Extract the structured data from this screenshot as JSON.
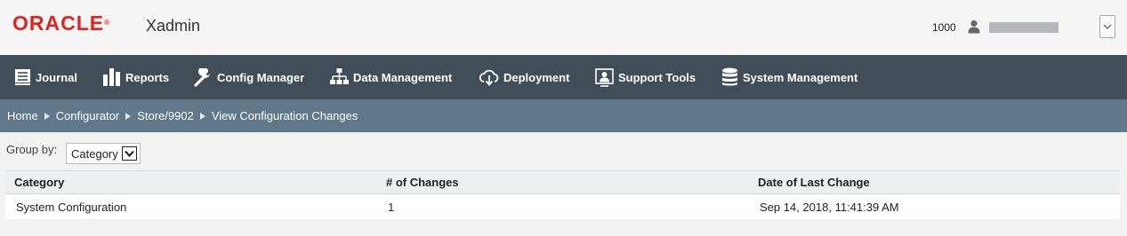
{
  "header": {
    "brand": "ORACLE",
    "brand_mark": "®",
    "app_title": "Xadmin",
    "store_number": "1000",
    "user_icon": "user-icon",
    "dropdown_icon": "chevron-down-icon"
  },
  "nav": {
    "items": [
      {
        "label": "Journal",
        "icon": "journal-icon"
      },
      {
        "label": "Reports",
        "icon": "reports-bar-chart-icon"
      },
      {
        "label": "Config Manager",
        "icon": "wrench-icon"
      },
      {
        "label": "Data Management",
        "icon": "hierarchy-icon"
      },
      {
        "label": "Deployment",
        "icon": "cloud-download-icon"
      },
      {
        "label": "Support Tools",
        "icon": "support-user-icon"
      },
      {
        "label": "System Management",
        "icon": "database-icon"
      }
    ]
  },
  "breadcrumb": {
    "items": [
      "Home",
      "Configurator",
      "Store/9902",
      "View Configuration Changes"
    ]
  },
  "groupby": {
    "label": "Group by:",
    "selected": "Category"
  },
  "table": {
    "columns": [
      "Category",
      "# of Changes",
      "Date of Last Change"
    ],
    "rows": [
      [
        "System Configuration",
        "1",
        "Sep 14, 2018, 11:41:39 AM"
      ]
    ]
  },
  "colors": {
    "brand_red": "#e0231f",
    "nav_bg": "#414d57",
    "breadcrumb_bg": "#61788b"
  }
}
